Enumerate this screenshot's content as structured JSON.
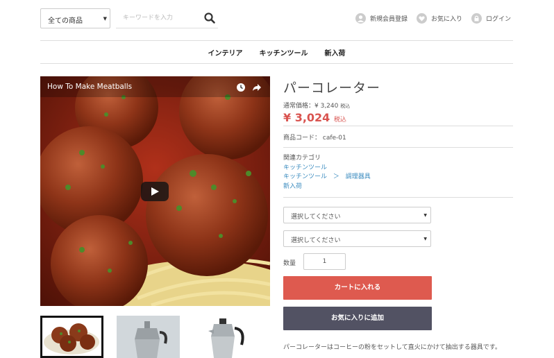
{
  "header": {
    "category_select": "全ての商品",
    "keyword_placeholder": "キーワードを入力",
    "signup_label": "新規会員登録",
    "favorites_label": "お気に入り",
    "login_label": "ログイン"
  },
  "nav": [
    "インテリア",
    "キッチンツール",
    "新入荷"
  ],
  "video": {
    "title": "How To Make Meatballs",
    "icons": [
      "clock-icon",
      "share-icon",
      "play-icon"
    ]
  },
  "product": {
    "name": "パーコレーター",
    "regular_price_label": "通常価格：¥ 3,240",
    "regular_tax": "税込",
    "price": "¥ 3,024",
    "price_tax": "税込",
    "code_label": "商品コード：",
    "code_value": "cafe-01",
    "related_label": "関連カテゴリ",
    "related_1": "キッチンツール",
    "related_2a": "キッチンツール",
    "related_sep": "＞",
    "related_2b": "調理器具",
    "related_3": "新入荷",
    "select_1": "選択してください",
    "select_2": "選択してください",
    "qty_label": "数量",
    "qty_value": "1",
    "cart_button": "カートに入れる",
    "fav_button": "お気に入りに追加",
    "description": "パーコレーターはコーヒーの粉をセットして直火にかけて抽出する器具です。"
  },
  "colors": {
    "accent_red": "#de5a4f",
    "price_red": "#d9534f",
    "dark_button": "#525263",
    "link_blue": "#3a8bbf"
  }
}
